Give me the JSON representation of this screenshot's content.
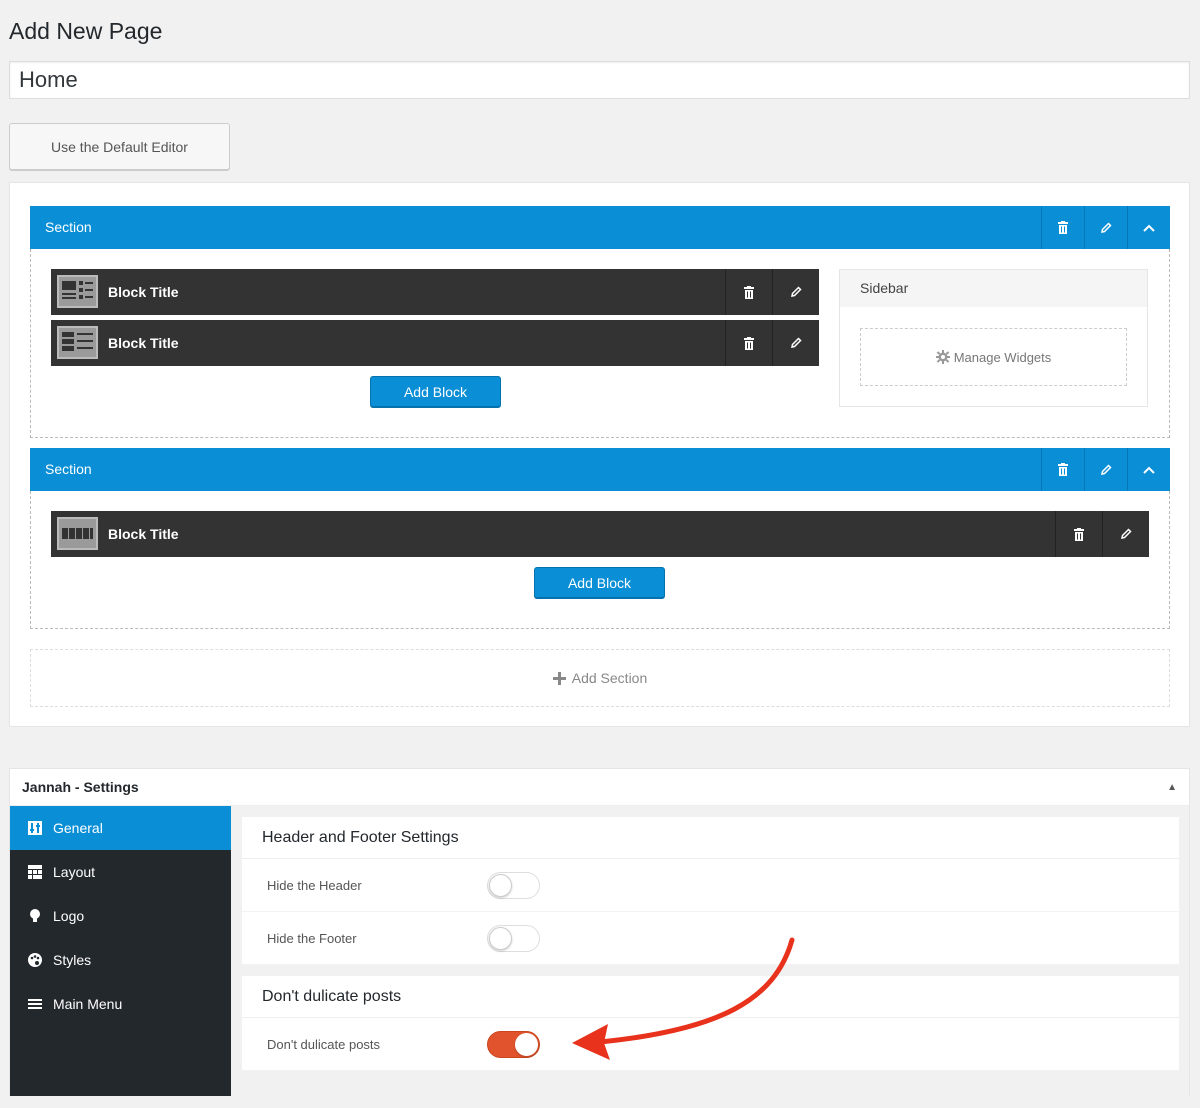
{
  "page": {
    "title": "Add New Page",
    "title_value": "Home",
    "default_editor_label": "Use the Default Editor"
  },
  "builder": {
    "sections": [
      {
        "label": "Section",
        "blocks": [
          {
            "title": "Block Title",
            "thumb_icon": "layout-thumb-icon"
          },
          {
            "title": "Block Title",
            "thumb_icon": "layout-thumb-icon"
          }
        ],
        "add_block_label": "Add Block",
        "sidebar": {
          "title": "Sidebar",
          "manage_widgets_label": "Manage Widgets"
        }
      },
      {
        "label": "Section",
        "blocks": [
          {
            "title": "Block Title",
            "thumb_icon": "slider-thumb-icon"
          }
        ],
        "add_block_label": "Add Block"
      }
    ],
    "add_section_label": "Add Section"
  },
  "settings": {
    "title": "Jannah - Settings",
    "nav": [
      {
        "label": "General",
        "icon": "general-icon",
        "active": true
      },
      {
        "label": "Layout",
        "icon": "layout-icon",
        "active": false
      },
      {
        "label": "Logo",
        "icon": "lightbulb-icon",
        "active": false
      },
      {
        "label": "Styles",
        "icon": "palette-icon",
        "active": false
      },
      {
        "label": "Main Menu",
        "icon": "menu-icon",
        "active": false
      }
    ],
    "panels": [
      {
        "title": "Header and Footer Settings",
        "options": [
          {
            "label": "Hide the Header",
            "on": false
          },
          {
            "label": "Hide the Footer",
            "on": false
          }
        ]
      },
      {
        "title": "Don't dulicate posts",
        "options": [
          {
            "label": "Don't dulicate posts",
            "on": true
          }
        ]
      }
    ]
  },
  "colors": {
    "accent": "#0a8ed6",
    "block_bg": "#333333",
    "nav_bg": "#23282d",
    "toggle_on": "#e0532d",
    "annotation_arrow": "#e8321c"
  }
}
